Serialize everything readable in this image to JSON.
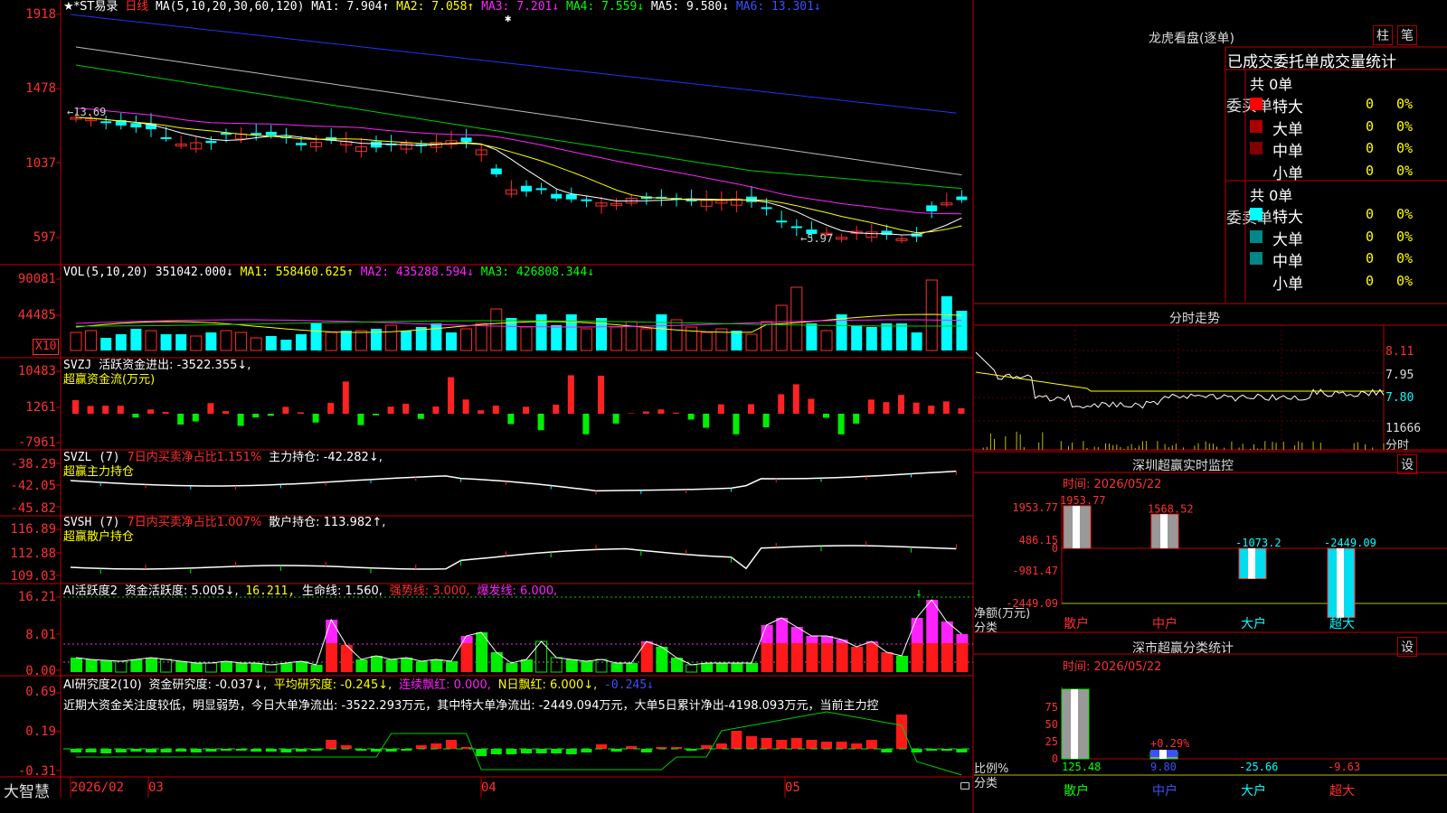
{
  "main_chart": {
    "header": {
      "stock_name": "★*ST易录",
      "period": "日线",
      "ma_label": "MA(5,10,20,30,60,120)",
      "ma1": "MA1: 7.904↑",
      "ma2": "MA2: 7.058↑",
      "ma3": "MA3: 7.201↓",
      "ma4": "MA4: 7.559↓",
      "ma5": "MA5: 9.580↓",
      "ma6": "MA6: 13.301↓"
    },
    "y_ticks": [
      "1918",
      "1478",
      "1037",
      "597"
    ],
    "high_marker": "←13.69",
    "low_marker": "←5.97"
  },
  "volume_panel": {
    "header": {
      "name": "VOL(5,10,20)",
      "value": "351042.000↓",
      "ma1": "MA1: 558460.625↑",
      "ma2": "MA2: 435288.594↓",
      "ma3": "MA3: 426808.344↓"
    },
    "y_ticks": [
      "90081",
      "44485"
    ],
    "unit": "X10"
  },
  "svzj_panel": {
    "header": {
      "name": "SVZJ",
      "desc": "活跃资金进出: -3522.355↓,",
      "sub": "超赢资金流(万元)"
    },
    "y_ticks": [
      "10483",
      "1261",
      "-7961"
    ]
  },
  "svzl_panel": {
    "header": {
      "name": "SVZL (7)",
      "ratio": "7日内买卖净占比1.151%",
      "hold": "主力持仓: -42.282↓,",
      "sub": "超赢主力持仓"
    },
    "y_ticks": [
      "-38.29",
      "-42.05",
      "-45.82"
    ]
  },
  "svsh_panel": {
    "header": {
      "name": "SVSH (7)",
      "ratio": "7日内买卖净占比1.007%",
      "hold": "散户持仓: 113.982↑,",
      "sub": "超赢散户持仓"
    },
    "y_ticks": [
      "116.89",
      "112.88",
      "109.03"
    ]
  },
  "ai_active_panel": {
    "header": {
      "name": "AI活跃度2",
      "active": "资金活跃度: 5.005↓,",
      "v2": "16.211,",
      "life": "生命线: 1.560,",
      "strong": "强势线: 3.000,",
      "burst": "爆发线: 6.000,"
    },
    "y_ticks": [
      "16.21",
      "8.01",
      "0.00"
    ]
  },
  "ai_research_panel": {
    "header": {
      "name": "AI研究度2(10)",
      "research": "资金研究度: -0.037↓,",
      "avg": "平均研究度: -0.245↓,",
      "cont": "连续飘红: 0.000,",
      "nday": "N日飘红: 6.000↓,",
      "last": "-0.245↓"
    },
    "commentary": "近期大资金关注度较低，明显弱势，今日大单净流出: -3522.293万元，其中特大单净流出: -2449.094万元，大单5日累计净出-4198.093万元，当前主力控",
    "y_ticks": [
      "0.69",
      "0.19",
      "-0.31"
    ]
  },
  "time_axis": {
    "brand": "大智慧",
    "labels": [
      "2026/02",
      "03",
      "04",
      "05"
    ]
  },
  "right": {
    "dragon_title": "龙虎看盘(逐单)",
    "btn_bar": "柱",
    "btn_pen": "笔",
    "stat_title": "已成交委托单成交量统计",
    "buy": {
      "label": "委买单",
      "total": "共 0单",
      "rows": [
        {
          "name": "特大",
          "count": "0",
          "pct": "0%"
        },
        {
          "name": "大单",
          "count": "0",
          "pct": "0%"
        },
        {
          "name": "中单",
          "count": "0",
          "pct": "0%"
        },
        {
          "name": "小单",
          "count": "0",
          "pct": "0%"
        }
      ]
    },
    "sell": {
      "label": "委卖单",
      "total": "共 0单",
      "rows": [
        {
          "name": "特大",
          "count": "0",
          "pct": "0%"
        },
        {
          "name": "大单",
          "count": "0",
          "pct": "0%"
        },
        {
          "name": "中单",
          "count": "0",
          "pct": "0%"
        },
        {
          "name": "小单",
          "count": "0",
          "pct": "0%"
        }
      ]
    },
    "colors": {
      "buy": [
        "#ff0000",
        "#aa0000",
        "#800000"
      ],
      "sell": [
        "#00ffff",
        "#008888",
        "#008888"
      ]
    },
    "intraday": {
      "title": "分时走势",
      "prices": [
        "8.11",
        "7.95",
        "7.80"
      ],
      "vol": "11666",
      "footer": "分时"
    },
    "sz_monitor": {
      "title": "深圳超赢实时监控",
      "set": "设",
      "date": "时间: 2026/05/22",
      "y_ticks": [
        "1953.77",
        "486.15",
        "0",
        "-981.47",
        "-2449.09"
      ],
      "bar_values": [
        "1953.77",
        "1568.52",
        "-1073.2",
        "-2449.09"
      ],
      "y_title": "净额(万元)",
      "x_title": "分类",
      "categories": [
        "散户",
        "中户",
        "大户",
        "超大"
      ]
    },
    "sz_class": {
      "title": "深市超赢分类统计",
      "set": "设",
      "date": "时间: 2026/05/22",
      "y_ticks": [
        "75",
        "50",
        "25",
        "0"
      ],
      "bar_labels": [
        "+0.29%"
      ],
      "values": [
        "125.48",
        "9.80",
        "-25.66",
        "-9.63"
      ],
      "y_title": "比例%",
      "x_title": "分类",
      "categories": [
        "散户",
        "中户",
        "大户",
        "超大"
      ]
    }
  }
}
